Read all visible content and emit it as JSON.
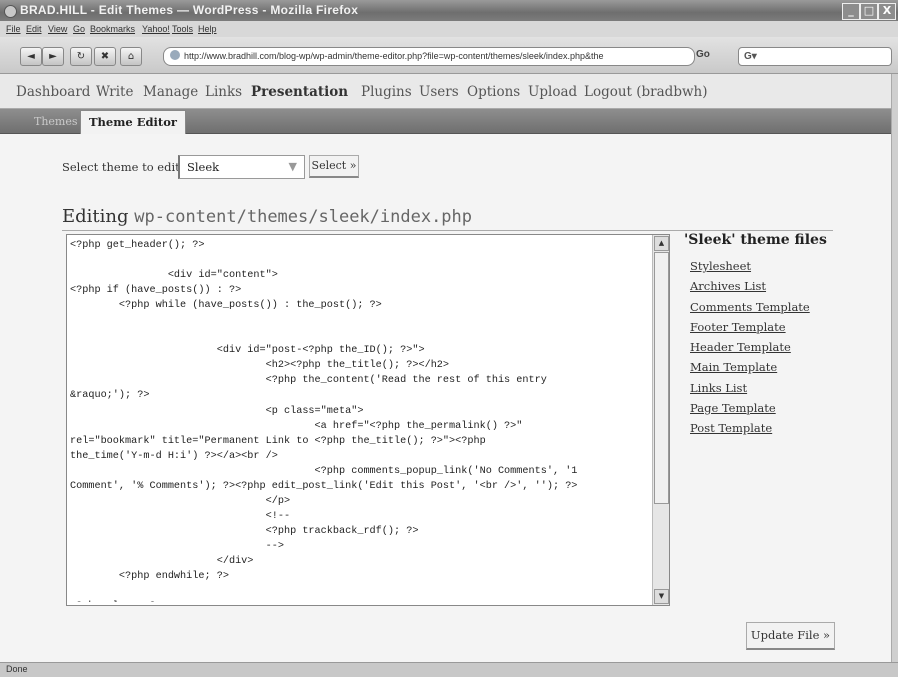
{
  "browser": {
    "title": "BRAD.HILL - Edit Themes — WordPress - Mozilla Firefox",
    "window_buttons": [
      "_",
      "□",
      "X"
    ],
    "menu": [
      "File",
      "Edit",
      "View",
      "Go",
      "Bookmarks",
      "Yahoo!",
      "Tools",
      "Help"
    ],
    "nav_buttons": [
      "◄",
      "►",
      "↻",
      "✖",
      "⌂"
    ],
    "url": "http://www.bradhill.com/blog-wp/wp-admin/theme-editor.php?file=wp-content/themes/sleek/index.php&the",
    "go_label": "Go",
    "search_label": "G▾",
    "status": "Done"
  },
  "wp": {
    "menu": [
      "Dashboard",
      "Write",
      "Manage",
      "Links",
      "Presentation",
      "Plugins",
      "Users",
      "Options",
      "Upload",
      "Logout (bradbwh)"
    ],
    "active_menu": "Presentation",
    "submenu": {
      "themes_label": "Themes",
      "editor_label": "Theme Editor"
    },
    "select_label": "Select theme to edit:",
    "selected_theme": "Sleek",
    "select_button": "Select »",
    "editing_label": "Editing",
    "file_path": "wp-content/themes/sleek/index.php",
    "code": "<?php get_header(); ?>\n\n                <div id=\"content\">\n<?php if (have_posts()) : ?>\n        <?php while (have_posts()) : the_post(); ?>\n\n\n                        <div id=\"post-<?php the_ID(); ?>\">\n                                <h2><?php the_title(); ?></h2>\n                                <?php the_content('Read the rest of this entry\n&raquo;'); ?>\n                                <p class=\"meta\">\n                                        <a href=\"<?php the_permalink() ?>\"\nrel=\"bookmark\" title=\"Permanent Link to <?php the_title(); ?>\"><?php\nthe_time('Y-m-d H:i') ?></a><br />\n                                        <?php comments_popup_link('No Comments', '1\nComment', '% Comments'); ?><?php edit_post_link('Edit this Post', '<br />', ''); ?>\n                                </p>\n                                <!--\n                                <?php trackback_rdf(); ?>\n                                -->\n                        </div>\n        <?php endwhile; ?>\n\n<?php else : ?>\n                        <div id=\"post-notfound\">",
    "files_title": "'Sleek' theme files",
    "files": [
      "Stylesheet",
      "Archives List",
      "Comments Template",
      "Footer Template",
      "Header Template",
      "Main Template",
      "Links List",
      "Page Template",
      "Post Template"
    ],
    "update_button": "Update File »"
  }
}
